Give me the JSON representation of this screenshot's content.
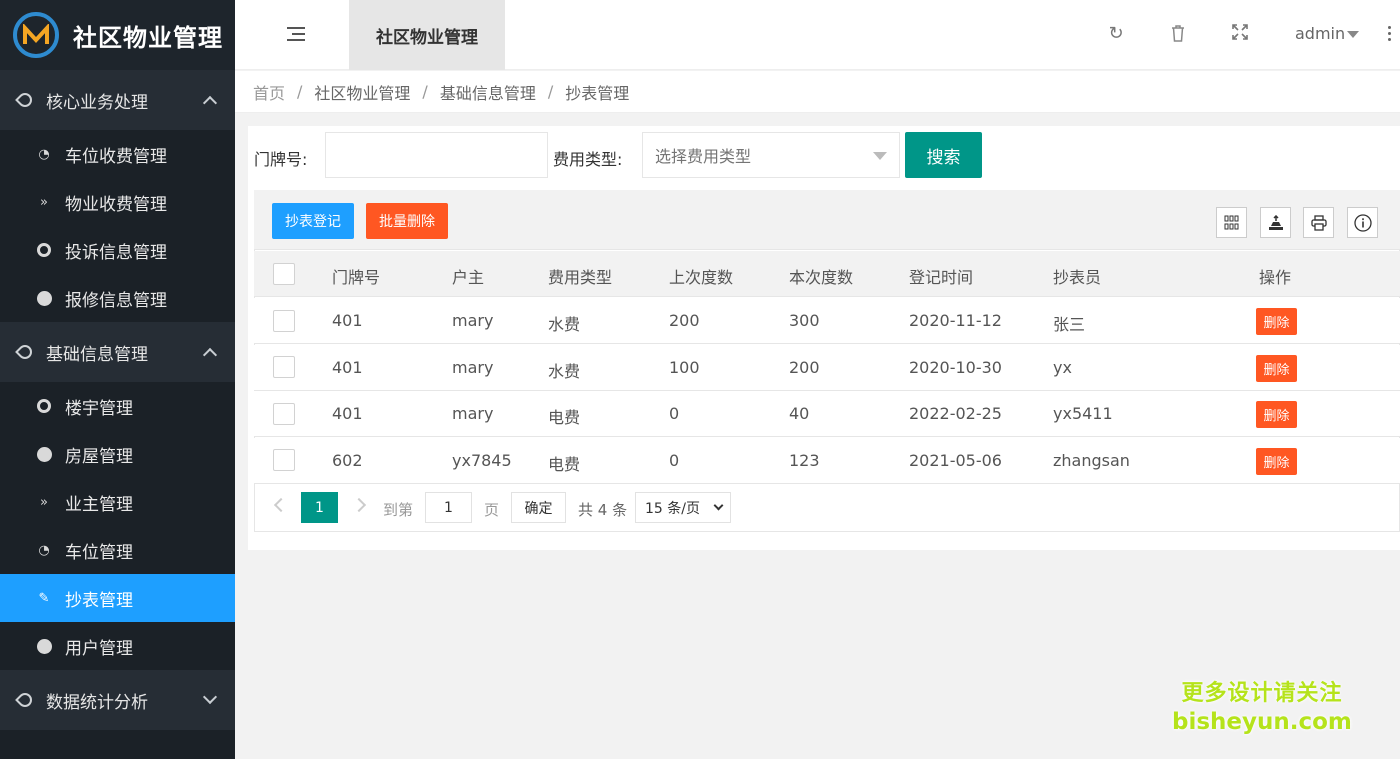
{
  "app": {
    "title": "社区物业管理",
    "user": "admin"
  },
  "sidebar": {
    "groups": [
      {
        "label": "核心业务处理",
        "items": [
          "车位收费管理",
          "物业收费管理",
          "投诉信息管理",
          "报修信息管理"
        ]
      },
      {
        "label": "基础信息管理",
        "items": [
          "楼宇管理",
          "房屋管理",
          "业主管理",
          "车位管理",
          "抄表管理",
          "用户管理"
        ]
      },
      {
        "label": "数据统计分析",
        "items": []
      }
    ],
    "active_item": "抄表管理"
  },
  "header": {
    "active_tab": "社区物业管理"
  },
  "breadcrumb": [
    "首页",
    "社区物业管理",
    "基础信息管理",
    "抄表管理"
  ],
  "filters": {
    "door_label": "门牌号:",
    "door_value": "",
    "fee_type_label": "费用类型:",
    "fee_type_placeholder": "选择费用类型",
    "search_label": "搜索"
  },
  "toolbar": {
    "add_label": "抄表登记",
    "batch_delete_label": "批量删除"
  },
  "table": {
    "columns": [
      "门牌号",
      "户主",
      "费用类型",
      "上次度数",
      "本次度数",
      "登记时间",
      "抄表员",
      "操作"
    ],
    "rows": [
      [
        "401",
        "mary",
        "水费",
        "200",
        "300",
        "2020-11-12",
        "张三"
      ],
      [
        "401",
        "mary",
        "水费",
        "100",
        "200",
        "2020-10-30",
        "yx"
      ],
      [
        "401",
        "mary",
        "电费",
        "0",
        "40",
        "2022-02-25",
        "yx5411"
      ],
      [
        "602",
        "yx7845",
        "电费",
        "0",
        "123",
        "2021-05-06",
        "zhangsan"
      ]
    ],
    "row_action": "删除"
  },
  "pager": {
    "current": "1",
    "goto_label": "到第",
    "goto_value": "1",
    "page_unit": "页",
    "confirm": "确定",
    "total": "共 4 条",
    "page_size": "15 条/页"
  },
  "watermark": {
    "line1": "更多设计请关注",
    "line2": "bisheyun.com"
  },
  "colors": {
    "sidebar_bg": "#1b2127",
    "active_blue": "#1e9fff",
    "primary_green": "#009688",
    "danger_orange": "#ff5722"
  }
}
